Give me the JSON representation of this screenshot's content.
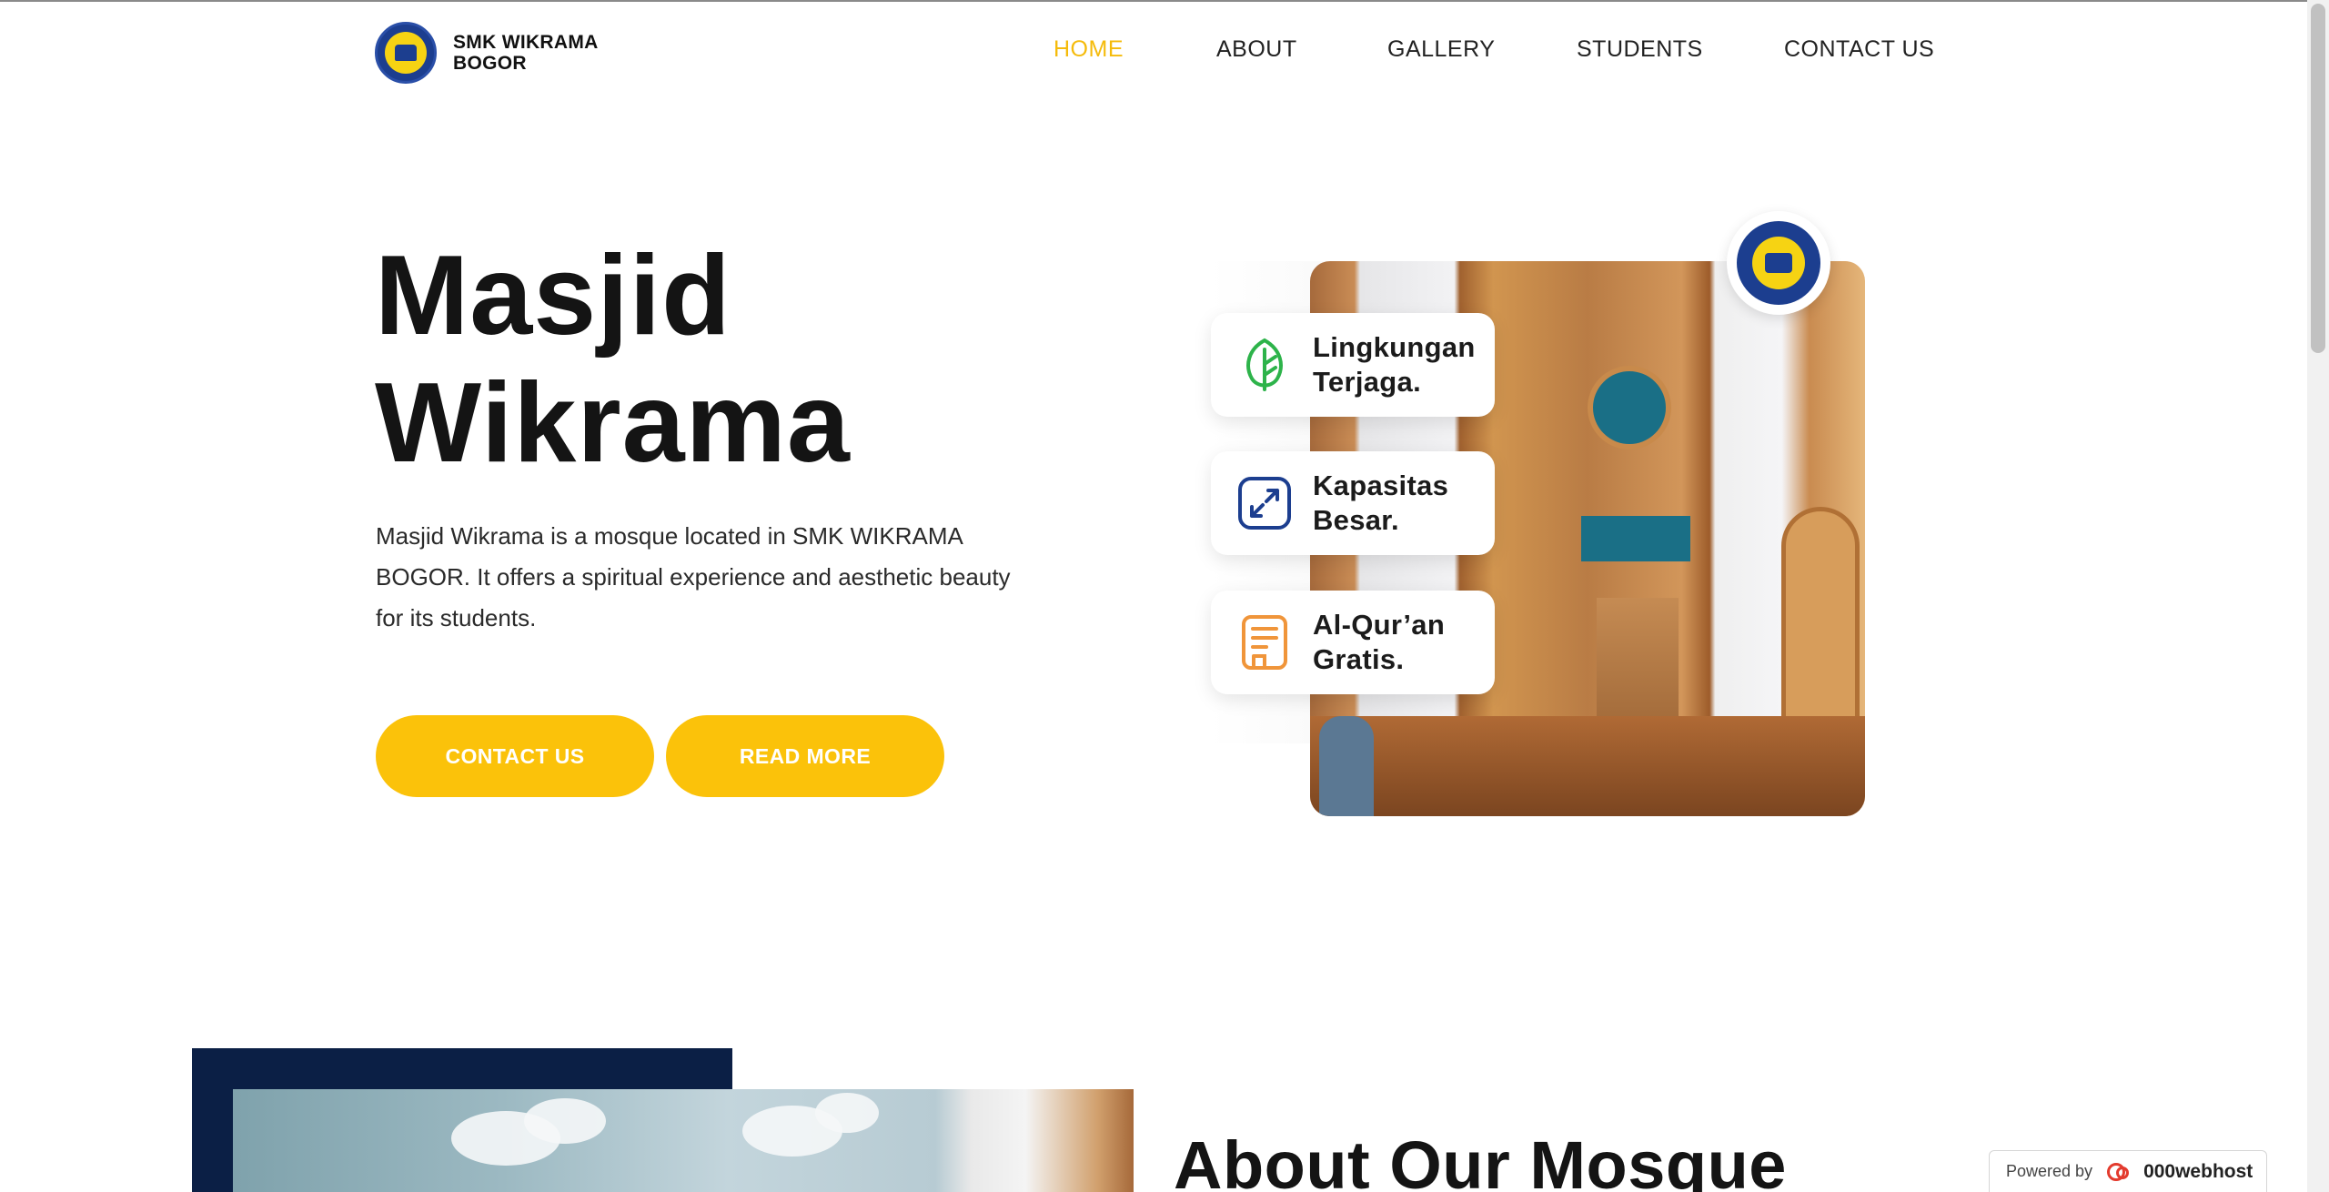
{
  "brand": {
    "line1": "SMK WIKRAMA",
    "line2": "BOGOR"
  },
  "nav": {
    "items": [
      {
        "label": "HOME",
        "active": true
      },
      {
        "label": "ABOUT",
        "active": false
      },
      {
        "label": "GALLERY",
        "active": false
      },
      {
        "label": "STUDENTS",
        "active": false
      },
      {
        "label": "CONTACT US",
        "active": false
      }
    ]
  },
  "hero": {
    "title_line1": "Masjid",
    "title_line2": "Wikrama",
    "description": "Masjid Wikrama is a mosque located in SMK WIKRAMA BOGOR. It offers a spiritual experience and aesthetic beauty for its students.",
    "contact_button": "CONTACT US",
    "read_more_button": "READ MORE"
  },
  "features": [
    {
      "line1": "Lingkungan",
      "line2": "Terjaga.",
      "icon": "leaf-icon",
      "color": "#2db34a"
    },
    {
      "line1": "Kapasitas",
      "line2": "Besar.",
      "icon": "expand-icon",
      "color": "#1c3e8f"
    },
    {
      "line1": "Al-Qur’an",
      "line2": "Gratis.",
      "icon": "book-icon",
      "color": "#f0953a"
    }
  ],
  "about": {
    "title": "About Our Mosque"
  },
  "badge": {
    "powered": "Powered by",
    "host": "000webhost"
  },
  "colors": {
    "accent": "#fbc20a",
    "nav_active": "#f5bb0b",
    "navy": "#0b1f45"
  }
}
